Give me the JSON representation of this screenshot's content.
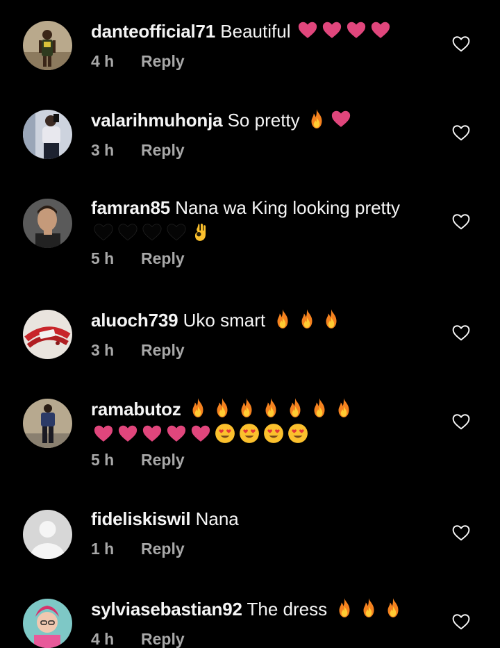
{
  "comments": [
    {
      "username": "danteofficial71",
      "text": "Beautiful",
      "emojis_line1": [
        "heart",
        "heart",
        "heart",
        "heart"
      ],
      "emojis_line2": [],
      "time": "4 h",
      "reply_label": "Reply",
      "avatar": "person-outdoor"
    },
    {
      "username": "valarihmuhonja",
      "text": "So pretty",
      "emojis_line1": [
        "fire",
        "heart"
      ],
      "emojis_line2": [],
      "time": "3 h",
      "reply_label": "Reply",
      "avatar": "person-mirror"
    },
    {
      "username": "famran85",
      "text": "Nana wa King looking pretty",
      "emojis_line1": [],
      "emojis_line2": [
        "black-heart",
        "black-heart",
        "black-heart",
        "black-heart",
        "ok-hand"
      ],
      "time": "5 h",
      "reply_label": "Reply",
      "avatar": "person-portrait"
    },
    {
      "username": "aluoch739",
      "text": "Uko smart",
      "emojis_line1": [
        "fire",
        "fire",
        "fire"
      ],
      "emojis_line2": [],
      "time": "3 h",
      "reply_label": "Reply",
      "avatar": "bracelet"
    },
    {
      "username": "ramabutoz",
      "text": "",
      "emojis_line1": [
        "fire",
        "fire",
        "fire",
        "fire",
        "fire",
        "fire",
        "fire"
      ],
      "emojis_line2": [
        "heart",
        "heart",
        "heart",
        "heart",
        "heart",
        "heart-eyes",
        "heart-eyes",
        "heart-eyes",
        "heart-eyes"
      ],
      "time": "5 h",
      "reply_label": "Reply",
      "avatar": "person-standing"
    },
    {
      "username": "fideliskiswil",
      "text": "Nana",
      "emojis_line1": [],
      "emojis_line2": [],
      "time": "1 h",
      "reply_label": "Reply",
      "avatar": "default"
    },
    {
      "username": "sylviasebastian92",
      "text": "The dress",
      "emojis_line1": [
        "fire",
        "fire",
        "fire"
      ],
      "emojis_line2": [],
      "time": "4 h",
      "reply_label": "Reply",
      "avatar": "person-colorful"
    }
  ],
  "icons": {
    "like": "heart-outline-icon",
    "reply": "reply-link"
  },
  "colors": {
    "background": "#000000",
    "text": "#f5f5f5",
    "meta": "#a8a8a8",
    "heart_emoji": "#e0467c",
    "fire_emoji": "#f5821f"
  }
}
